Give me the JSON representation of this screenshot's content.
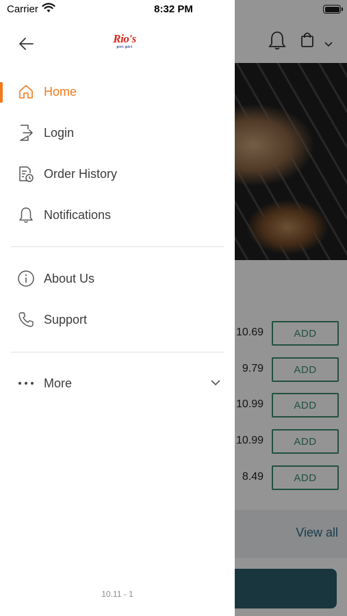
{
  "status_bar": {
    "carrier": "Carrier",
    "time": "8:32 PM"
  },
  "drawer": {
    "logo": {
      "brand": "Rio's",
      "tagline": "piri piri"
    },
    "menu": [
      {
        "label": "Home",
        "icon": "home-icon",
        "active": true
      },
      {
        "label": "Login",
        "icon": "login-icon",
        "active": false
      },
      {
        "label": "Order History",
        "icon": "order-history-icon",
        "active": false
      },
      {
        "label": "Notifications",
        "icon": "bell-icon",
        "active": false
      }
    ],
    "secondary_menu": [
      {
        "label": "About Us",
        "icon": "info-icon"
      },
      {
        "label": "Support",
        "icon": "phone-icon"
      }
    ],
    "more": {
      "label": "More",
      "icon": "more-dots-icon"
    },
    "version": "10.11 - 1"
  },
  "background_app": {
    "prices": [
      "10.69",
      "9.79",
      "10.99",
      "10.99",
      "8.49"
    ],
    "add_label": "ADD",
    "view_all": "View all"
  },
  "colors": {
    "accent": "#f07a1c",
    "add_button": "#3a8a6a",
    "view_all": "#2a6a8a",
    "cta": "#2b5d6b"
  }
}
